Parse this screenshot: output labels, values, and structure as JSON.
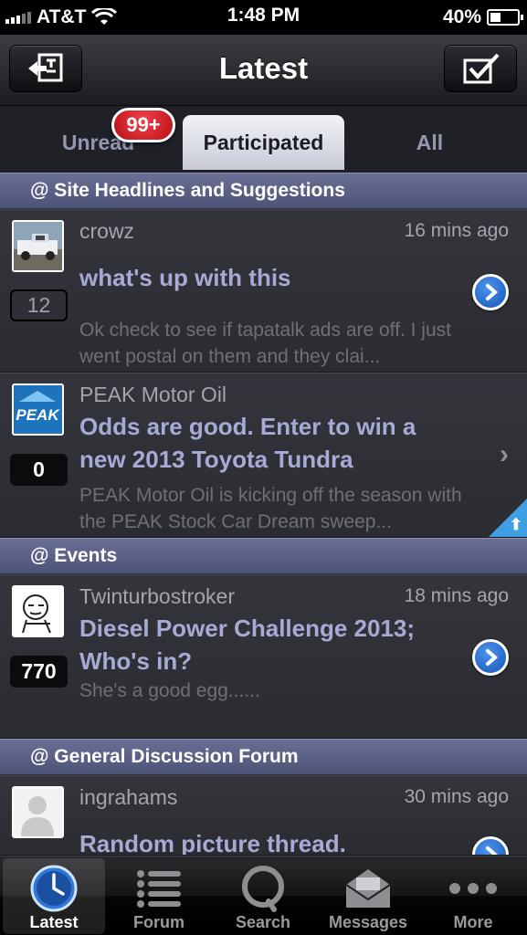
{
  "status_bar": {
    "carrier": "AT&T",
    "time": "1:48 PM",
    "battery": "40%",
    "battery_level": 0.4
  },
  "nav": {
    "title": "Latest",
    "left_icon": "account-switch-icon",
    "right_icon": "mark-read-icon"
  },
  "tabs": {
    "unread": "Unread",
    "participated": "Participated",
    "all": "All",
    "unread_badge": "99+"
  },
  "sections": {
    "headlines": "@ Site Headlines and Suggestions",
    "events": "@ Events",
    "general": "@ General Discussion Forum"
  },
  "topics": [
    {
      "author": "crowz",
      "time": "16 mins ago",
      "title": "what's up with this",
      "preview": "Ok check to see if tapatalk ads are off. I just went postal on them and they clai...",
      "count": "12"
    },
    {
      "author": "PEAK Motor Oil",
      "time": "",
      "title": "Odds are good. Enter to win a new 2013 Toyota Tundra",
      "preview": "PEAK Motor Oil is kicking off the season with the PEAK Stock Car Dream sweep...",
      "count": "0",
      "avatar_text": "PEAK"
    },
    {
      "author": "Twinturbostroker",
      "time": "18 mins ago",
      "title": "Diesel Power Challenge 2013; Who's in?",
      "preview": "She's a good egg......",
      "count": "770"
    },
    {
      "author": "ingrahams",
      "time": "30 mins ago",
      "title": "Random picture thread.",
      "preview": "",
      "count": ""
    }
  ],
  "tab_bar": [
    {
      "label": "Latest",
      "icon": "clock-icon"
    },
    {
      "label": "Forum",
      "icon": "list-icon"
    },
    {
      "label": "Search",
      "icon": "search-icon"
    },
    {
      "label": "Messages",
      "icon": "envelope-icon"
    },
    {
      "label": "More",
      "icon": "more-dots-icon"
    }
  ],
  "colors": {
    "section_header": "#5a5f85",
    "title_text": "#a6abd6",
    "accent_blue": "#2f78d8",
    "badge_red": "#d9232d"
  }
}
